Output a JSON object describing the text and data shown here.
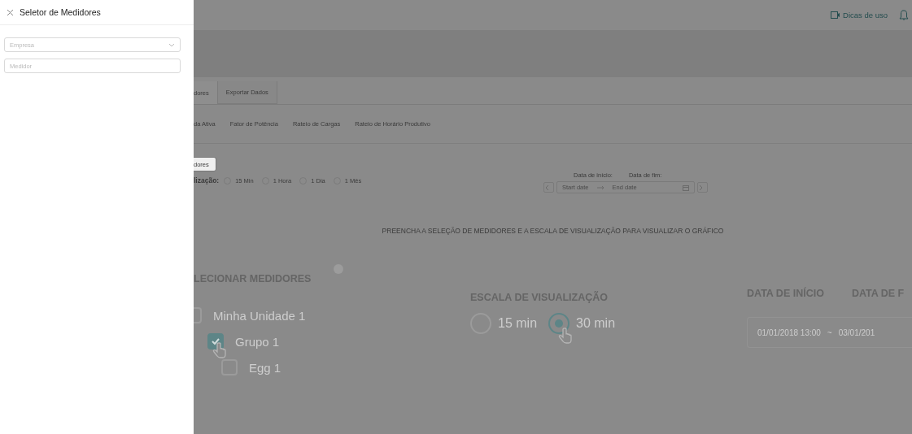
{
  "drawer": {
    "title": "Seletor de Medidores",
    "fields": [
      {
        "kind": "select",
        "placeholder": "Empresa"
      },
      {
        "kind": "input",
        "placeholder": "Medidor"
      }
    ]
  },
  "header": {
    "tips_link": "Dicas de uso"
  },
  "tabs": [
    {
      "label": "dores",
      "selected": true
    },
    {
      "label": "Exportar Dados",
      "selected": false
    }
  ],
  "subtabs": [
    {
      "label": "da Ativa",
      "selected": false
    },
    {
      "label": "Fator de Potência",
      "selected": false
    },
    {
      "label": "Rateio de Cargas",
      "selected": false
    },
    {
      "label": "Rateio de Horário Produtivo",
      "selected": false
    }
  ],
  "select_button": "dores",
  "scale": {
    "label": "lização:",
    "options": [
      {
        "label": "15 Min",
        "selected": false
      },
      {
        "label": "1 Hora",
        "selected": false
      },
      {
        "label": "1 Dia",
        "selected": false
      },
      {
        "label": "1 Mês",
        "selected": false
      }
    ]
  },
  "dates": {
    "start_label": "Data de início:",
    "end_label": "Data de fim:",
    "start_placeholder": "Start date",
    "end_placeholder": "End date"
  },
  "message": "PREENCHA A SELEÇÃO DE MEDIDORES E A ESCALA DE VISUALIZAÇÃO PARA VISUALIZAR O GRÁFICO",
  "tutorial": {
    "meters_heading": "LECIONAR MEDIDORES",
    "meters": [
      {
        "label": "Minha Unidade 1",
        "checked": false,
        "children": [
          {
            "label": "Grupo 1",
            "checked": true,
            "children": [
              {
                "label": "Egg 1",
                "checked": false
              }
            ]
          }
        ]
      }
    ],
    "scale_heading": "ESCALA DE VISUALIZAÇÃO",
    "scale_options": [
      {
        "label": "15 min",
        "selected": false
      },
      {
        "label": "30 min",
        "selected": true
      }
    ],
    "start_heading": "DATA DE INÍCIO",
    "end_heading": "DATA DE F",
    "range_start": "01/01/2018 13:00",
    "range_separator": "~",
    "range_end": "03/01/201"
  }
}
